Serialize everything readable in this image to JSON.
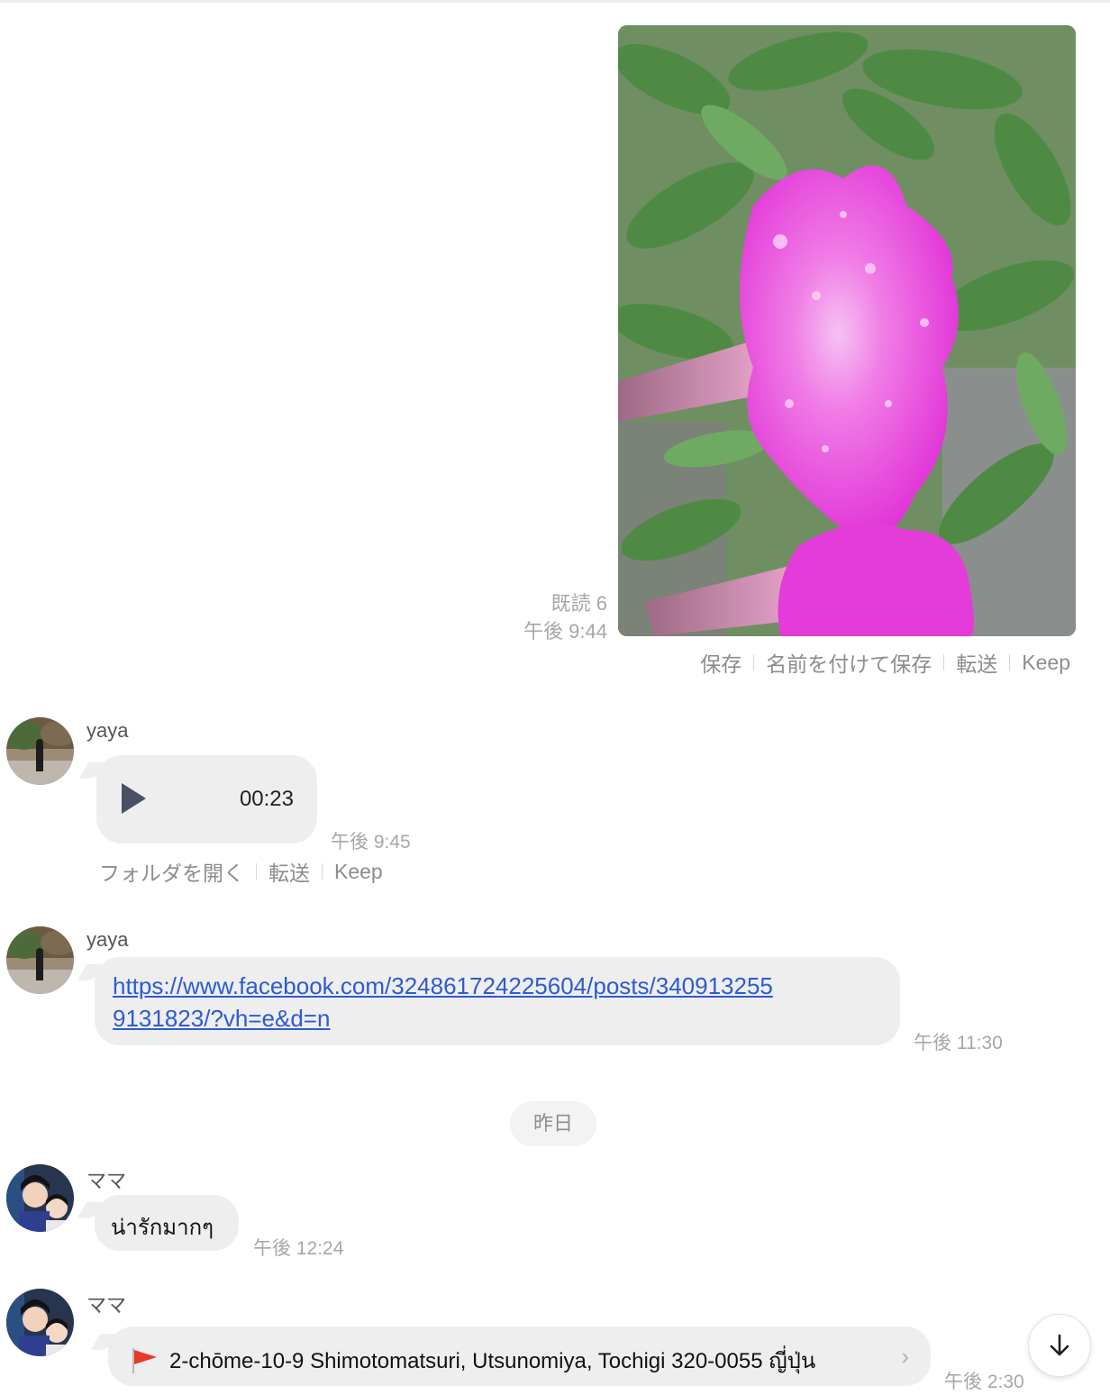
{
  "outgoing_photo": {
    "read_receipt": "既読 6",
    "time": "午後 9:44",
    "actions": [
      "保存",
      "名前を付けて保存",
      "転送",
      "Keep"
    ]
  },
  "voice_message": {
    "sender": "yaya",
    "duration": "00:23",
    "time": "午後 9:45",
    "actions": [
      "フォルダを開く",
      "転送",
      "Keep"
    ]
  },
  "link_message": {
    "sender": "yaya",
    "url": "https://www.facebook.com/324861724225604/posts/3409132559131823/?vh=e&d=n",
    "time": "午後 11:30"
  },
  "date_separator": "昨日",
  "text_message": {
    "sender": "ママ",
    "text": "น่ารักมากๆ",
    "time": "午後 12:24"
  },
  "location_message": {
    "sender": "ママ",
    "address": "2-chōme-10-9 Shimotomatsuri, Utsunomiya, Tochigi 320-0055 ญี่ปุ่น",
    "time": "午後 2:30"
  },
  "icons": {
    "play": "play-icon",
    "flag": "location-flag-icon",
    "chevron": "chevron-right-icon",
    "scroll": "arrow-down-icon"
  },
  "colors": {
    "bubble": "#eeeeee",
    "link": "#2d5bd0",
    "meta": "#a7a7a7",
    "flag": "#e8392b"
  }
}
